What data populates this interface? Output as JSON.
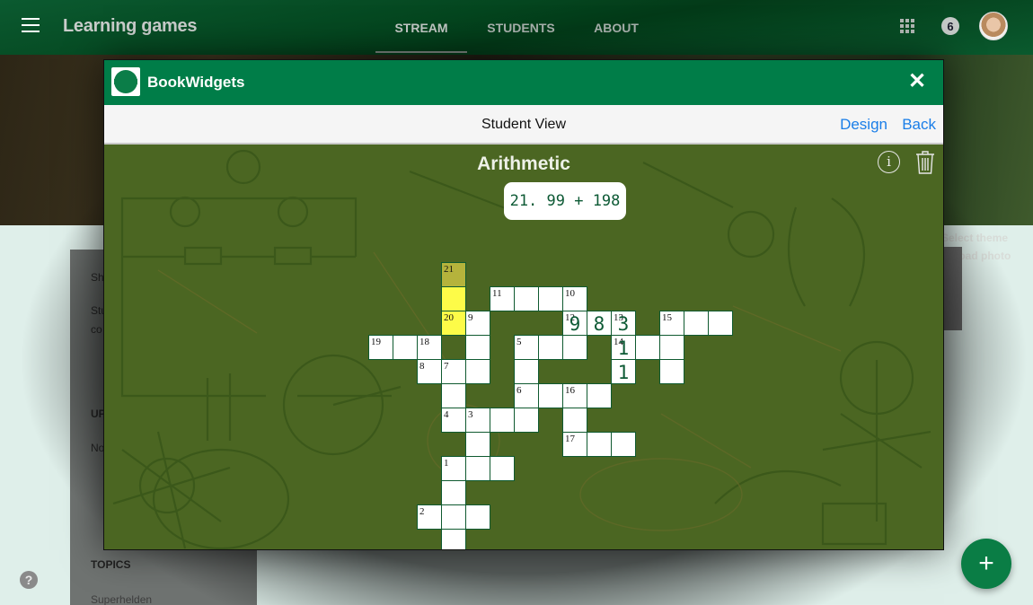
{
  "topbar": {
    "title": "Learning games",
    "tabs": [
      {
        "label": "STREAM",
        "active": true
      },
      {
        "label": "STUDENTS",
        "active": false
      },
      {
        "label": "ABOUT",
        "active": false
      }
    ],
    "notification_count": "6"
  },
  "banner": {
    "select_theme": "Select theme",
    "upload_photo": "Upload photo"
  },
  "sidebar": {
    "partial_texts": [
      "Sh",
      "Stu",
      "co",
      "UP",
      "No"
    ],
    "topics_heading": "TOPICS",
    "topics": [
      "Superhelden"
    ]
  },
  "modal": {
    "brand": "BookWidgets",
    "close_icon": "close-icon",
    "view_title": "Student View",
    "design_label": "Design",
    "back_label": "Back",
    "game_title": "Arithmetic",
    "current_clue": "21. 99 + 198",
    "colors": {
      "header": "#007d48",
      "board": "#4b6622",
      "highlight": "#fdfb48",
      "highlight_active": "#b5b33c",
      "link": "#1a7ee8"
    }
  },
  "crossword": {
    "cells": [
      {
        "r": 0,
        "c": 3,
        "num": "21",
        "letter": "",
        "state": "active"
      },
      {
        "r": 1,
        "c": 3,
        "num": "",
        "letter": "",
        "state": "selected"
      },
      {
        "r": 1,
        "c": 5,
        "num": "11",
        "letter": "",
        "state": ""
      },
      {
        "r": 1,
        "c": 6,
        "num": "",
        "letter": "",
        "state": ""
      },
      {
        "r": 1,
        "c": 7,
        "num": "",
        "letter": "",
        "state": ""
      },
      {
        "r": 1,
        "c": 8,
        "num": "10",
        "letter": "",
        "state": ""
      },
      {
        "r": 2,
        "c": 3,
        "num": "20",
        "letter": "",
        "state": "selected"
      },
      {
        "r": 2,
        "c": 4,
        "num": "9",
        "letter": "",
        "state": ""
      },
      {
        "r": 2,
        "c": 8,
        "num": "12",
        "letter": "9",
        "state": ""
      },
      {
        "r": 2,
        "c": 9,
        "num": "",
        "letter": "8",
        "state": ""
      },
      {
        "r": 2,
        "c": 10,
        "num": "13",
        "letter": "3",
        "state": ""
      },
      {
        "r": 2,
        "c": 12,
        "num": "15",
        "letter": "",
        "state": ""
      },
      {
        "r": 2,
        "c": 13,
        "num": "",
        "letter": "",
        "state": ""
      },
      {
        "r": 2,
        "c": 14,
        "num": "",
        "letter": "",
        "state": ""
      },
      {
        "r": 3,
        "c": 0,
        "num": "19",
        "letter": "",
        "state": ""
      },
      {
        "r": 3,
        "c": 1,
        "num": "",
        "letter": "",
        "state": ""
      },
      {
        "r": 3,
        "c": 2,
        "num": "18",
        "letter": "",
        "state": ""
      },
      {
        "r": 3,
        "c": 4,
        "num": "",
        "letter": "",
        "state": ""
      },
      {
        "r": 3,
        "c": 6,
        "num": "5",
        "letter": "",
        "state": ""
      },
      {
        "r": 3,
        "c": 7,
        "num": "",
        "letter": "",
        "state": ""
      },
      {
        "r": 3,
        "c": 8,
        "num": "",
        "letter": "",
        "state": ""
      },
      {
        "r": 3,
        "c": 10,
        "num": "14",
        "letter": "1",
        "state": ""
      },
      {
        "r": 3,
        "c": 11,
        "num": "",
        "letter": "",
        "state": ""
      },
      {
        "r": 3,
        "c": 12,
        "num": "",
        "letter": "",
        "state": ""
      },
      {
        "r": 4,
        "c": 2,
        "num": "8",
        "letter": "",
        "state": ""
      },
      {
        "r": 4,
        "c": 3,
        "num": "7",
        "letter": "",
        "state": ""
      },
      {
        "r": 4,
        "c": 4,
        "num": "",
        "letter": "",
        "state": ""
      },
      {
        "r": 4,
        "c": 6,
        "num": "",
        "letter": "",
        "state": ""
      },
      {
        "r": 4,
        "c": 10,
        "num": "",
        "letter": "1",
        "state": ""
      },
      {
        "r": 4,
        "c": 12,
        "num": "",
        "letter": "",
        "state": ""
      },
      {
        "r": 5,
        "c": 3,
        "num": "",
        "letter": "",
        "state": ""
      },
      {
        "r": 5,
        "c": 6,
        "num": "6",
        "letter": "",
        "state": ""
      },
      {
        "r": 5,
        "c": 7,
        "num": "",
        "letter": "",
        "state": ""
      },
      {
        "r": 5,
        "c": 8,
        "num": "16",
        "letter": "",
        "state": ""
      },
      {
        "r": 5,
        "c": 9,
        "num": "",
        "letter": "",
        "state": ""
      },
      {
        "r": 6,
        "c": 3,
        "num": "4",
        "letter": "",
        "state": ""
      },
      {
        "r": 6,
        "c": 4,
        "num": "3",
        "letter": "",
        "state": ""
      },
      {
        "r": 6,
        "c": 5,
        "num": "",
        "letter": "",
        "state": ""
      },
      {
        "r": 6,
        "c": 6,
        "num": "",
        "letter": "",
        "state": ""
      },
      {
        "r": 6,
        "c": 8,
        "num": "",
        "letter": "",
        "state": ""
      },
      {
        "r": 7,
        "c": 4,
        "num": "",
        "letter": "",
        "state": ""
      },
      {
        "r": 7,
        "c": 8,
        "num": "17",
        "letter": "",
        "state": ""
      },
      {
        "r": 7,
        "c": 9,
        "num": "",
        "letter": "",
        "state": ""
      },
      {
        "r": 7,
        "c": 10,
        "num": "",
        "letter": "",
        "state": ""
      },
      {
        "r": 8,
        "c": 3,
        "num": "1",
        "letter": "",
        "state": ""
      },
      {
        "r": 8,
        "c": 4,
        "num": "",
        "letter": "",
        "state": ""
      },
      {
        "r": 8,
        "c": 5,
        "num": "",
        "letter": "",
        "state": ""
      },
      {
        "r": 9,
        "c": 3,
        "num": "",
        "letter": "",
        "state": ""
      },
      {
        "r": 10,
        "c": 2,
        "num": "2",
        "letter": "",
        "state": ""
      },
      {
        "r": 10,
        "c": 3,
        "num": "",
        "letter": "",
        "state": ""
      },
      {
        "r": 10,
        "c": 4,
        "num": "",
        "letter": "",
        "state": ""
      },
      {
        "r": 11,
        "c": 3,
        "num": "",
        "letter": "",
        "state": ""
      }
    ]
  }
}
